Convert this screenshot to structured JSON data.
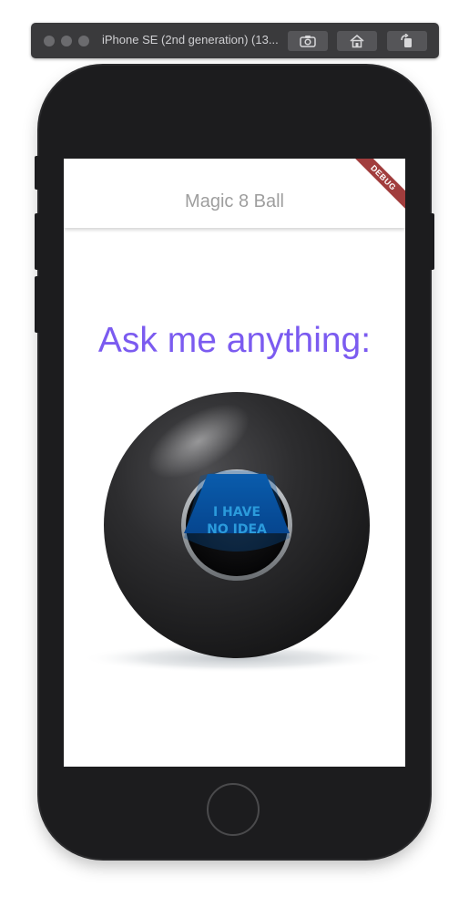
{
  "simulator": {
    "title": "iPhone SE (2nd generation) (13..."
  },
  "appbar": {
    "title": "Magic 8 Ball",
    "debug_banner": "DEBUG"
  },
  "main": {
    "prompt": "Ask me anything:",
    "ball": {
      "answer_line1": "I HAVE",
      "answer_line2": "NO IDEA"
    }
  },
  "colors": {
    "prompt": "#7b5bf0",
    "appbar_title": "#9e9e9e",
    "debug_banner": "#a13d3d",
    "answer_window": "#0a55a0",
    "answer_text": "#2b9bdc"
  }
}
